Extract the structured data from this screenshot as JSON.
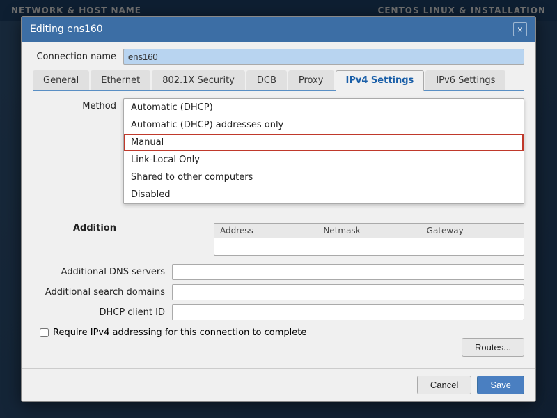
{
  "topbar": {
    "left": "NETWORK & HOST NAME",
    "right": "CENTOS LINUX & INSTALLATION"
  },
  "dialog": {
    "title": "Editing ens160",
    "close_label": "×",
    "connection_name_label": "Connection name",
    "connection_name_value": "ens160",
    "tabs": [
      {
        "id": "general",
        "label": "General"
      },
      {
        "id": "ethernet",
        "label": "Ethernet"
      },
      {
        "id": "802.1x",
        "label": "802.1X Security"
      },
      {
        "id": "dcb",
        "label": "DCB"
      },
      {
        "id": "proxy",
        "label": "Proxy"
      },
      {
        "id": "ipv4",
        "label": "IPv4 Settings"
      },
      {
        "id": "ipv6",
        "label": "IPv6 Settings"
      }
    ],
    "active_tab": "ipv4",
    "method_label": "Method",
    "dropdown_options": [
      {
        "id": "auto-dhcp",
        "label": "Automatic (DHCP)"
      },
      {
        "id": "auto-dhcp-addr",
        "label": "Automatic (DHCP) addresses only"
      },
      {
        "id": "manual",
        "label": "Manual"
      },
      {
        "id": "link-local",
        "label": "Link-Local Only"
      },
      {
        "id": "shared",
        "label": "Shared to other computers"
      },
      {
        "id": "disabled",
        "label": "Disabled"
      }
    ],
    "highlighted_option": "manual",
    "additional_label": "Addition",
    "addresses_columns": [
      "Address",
      "Netmask",
      "Gateway"
    ],
    "dns_servers_label": "Additional DNS servers",
    "search_domains_label": "Additional search domains",
    "dhcp_client_id_label": "DHCP client ID",
    "require_ipv4_label": "Require IPv4 addressing for this connection to complete",
    "routes_btn_label": "Routes...",
    "cancel_btn_label": "Cancel",
    "save_btn_label": "Save"
  }
}
